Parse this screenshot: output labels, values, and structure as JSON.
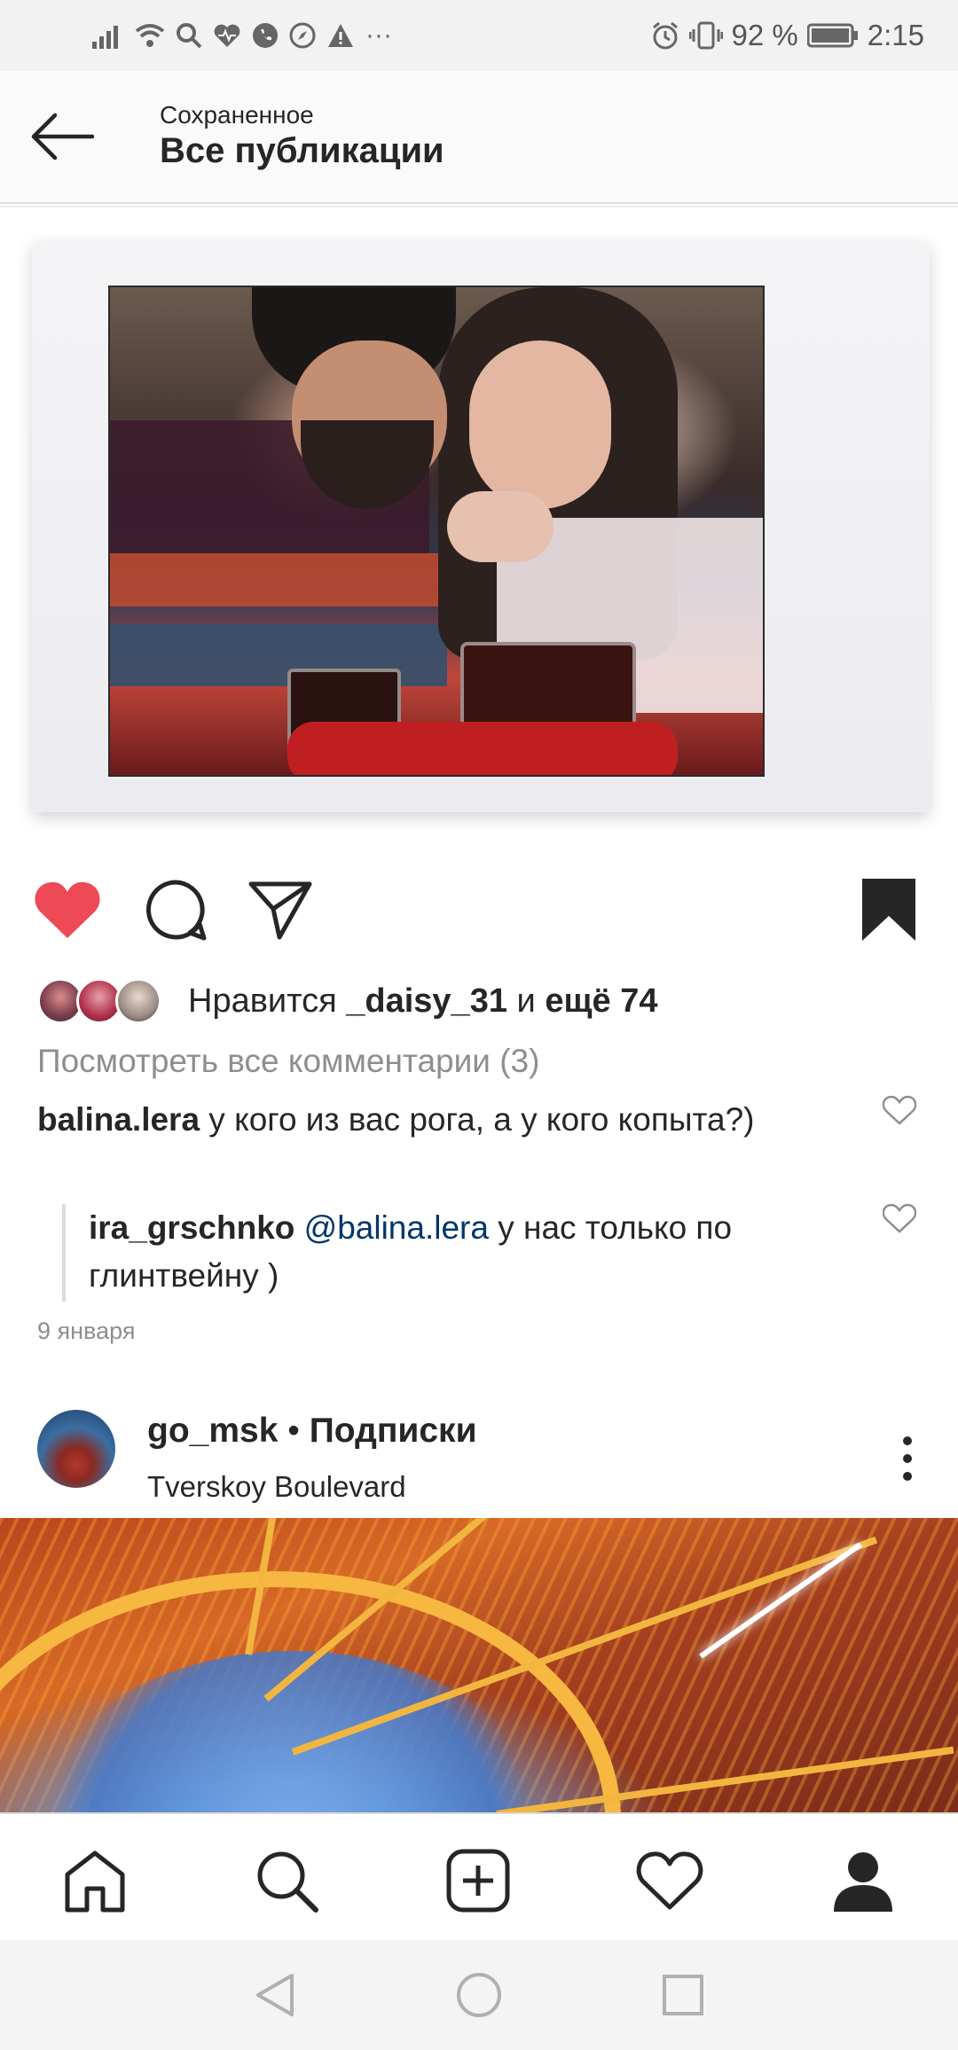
{
  "status_bar": {
    "battery": "92 %",
    "time": "2:15",
    "dots": "···"
  },
  "header": {
    "subtitle": "Сохраненное",
    "title": "Все публикации"
  },
  "post": {
    "likes": {
      "prefix": "Нравится ",
      "user": "_daisy_31",
      "middle": " и ",
      "more": "ещё 74"
    },
    "view_comments": "Посмотреть все комментарии (3)",
    "comment": {
      "user": "balina.lera",
      "text": " у кого из вас рога, а у кого копыта?)"
    },
    "reply": {
      "user": "ira_grschnko",
      "mention": "@balina.lera",
      "text": " у нас только по глинтвейну )"
    },
    "date": "9 января"
  },
  "next_post": {
    "username": "go_msk",
    "separator": " • ",
    "follow_status": "Подписки",
    "location": "Tverskoy Boulevard"
  },
  "colors": {
    "like_red": "#ed4956",
    "text": "#262626",
    "muted": "#8e8e8e",
    "mention": "#00376b"
  }
}
